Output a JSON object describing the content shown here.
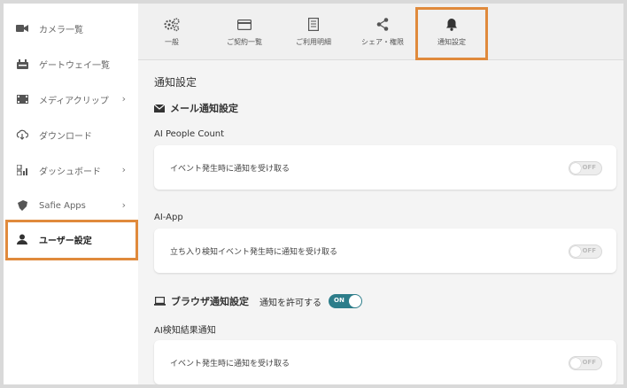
{
  "sidebar": {
    "items": [
      {
        "label": "カメラ一覧",
        "icon": "camera-icon",
        "chevron": ""
      },
      {
        "label": "ゲートウェイ一覧",
        "icon": "gateway-icon",
        "chevron": ""
      },
      {
        "label": "メディアクリップ",
        "icon": "film-icon",
        "chevron": "›"
      },
      {
        "label": "ダウンロード",
        "icon": "cloud-download-icon",
        "chevron": ""
      },
      {
        "label": "ダッシュボード",
        "icon": "dashboard-icon",
        "chevron": "›"
      },
      {
        "label": "Safie Apps",
        "icon": "apps-icon",
        "chevron": "›"
      },
      {
        "label": "ユーザー設定",
        "icon": "user-icon",
        "chevron": ""
      }
    ],
    "active_index": 6
  },
  "tabs": [
    {
      "label": "一般",
      "icon": "gears-icon"
    },
    {
      "label": "ご契約一覧",
      "icon": "card-icon"
    },
    {
      "label": "ご利用明細",
      "icon": "document-icon"
    },
    {
      "label": "シェア・権限",
      "icon": "share-icon"
    },
    {
      "label": "通知設定",
      "icon": "bell-icon"
    }
  ],
  "active_tab": 4,
  "content": {
    "page_title": "通知設定",
    "mail_section": "メール通知設定",
    "groups": [
      {
        "title": "AI People Count",
        "row": "イベント発生時に通知を受け取る",
        "toggle": "OFF"
      },
      {
        "title": "AI-App",
        "row": "立ち入り検知イベント発生時に通知を受け取る",
        "toggle": "OFF"
      }
    ],
    "browser_section": "ブラウザ通知設定",
    "browser_allow_label": "通知を許可する",
    "browser_allow_toggle": "ON",
    "browser_groups": [
      {
        "title": "AI検知結果通知",
        "row": "イベント発生時に通知を受け取る",
        "toggle": "OFF"
      }
    ]
  },
  "colors": {
    "accent": "#e08a3c",
    "toggle_on": "#2d7d8a"
  }
}
